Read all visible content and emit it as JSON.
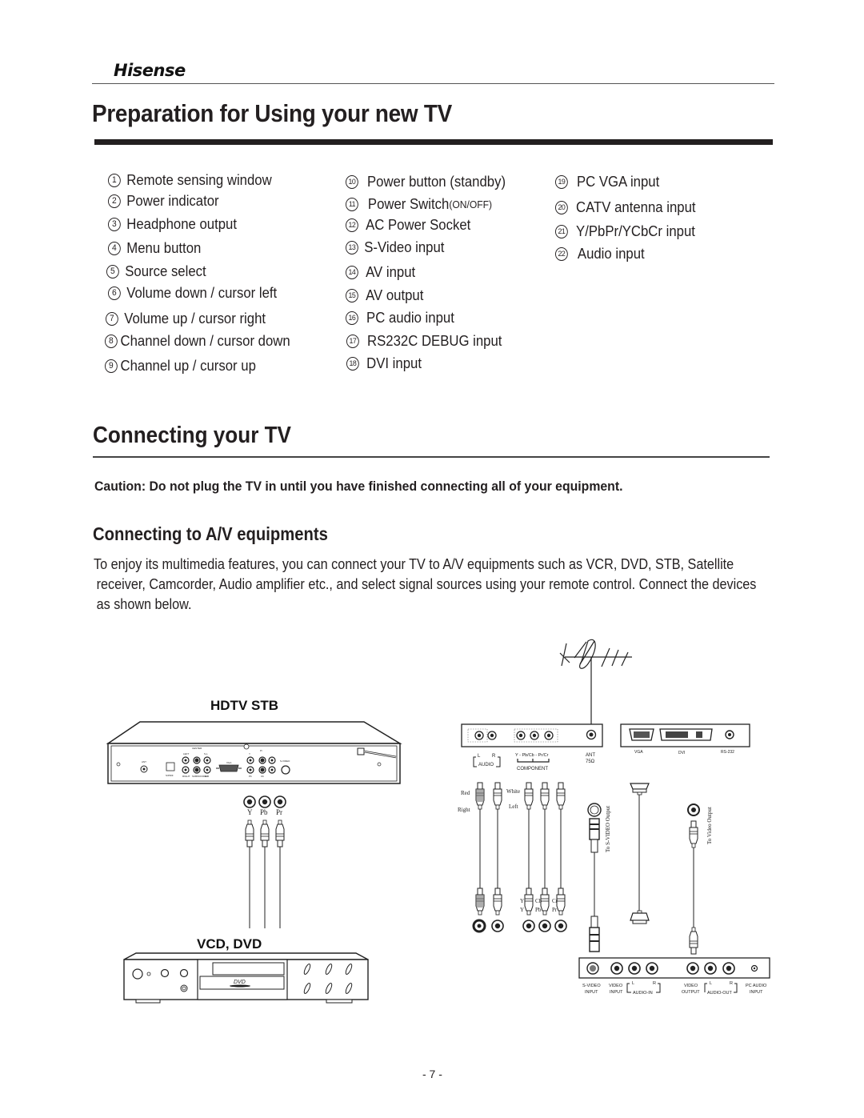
{
  "header": {
    "brand": "Hisense",
    "title": "Preparation for Using your new TV"
  },
  "legend": {
    "col1": [
      {
        "n": "1",
        "label": "Remote sensing window"
      },
      {
        "n": "2",
        "label": "Power indicator"
      },
      {
        "n": "3",
        "label": "Headphone output"
      },
      {
        "n": "4",
        "label": "Menu  button"
      },
      {
        "n": "5",
        "label": "Source select"
      },
      {
        "n": "6",
        "label": "Volume down / cursor left"
      },
      {
        "n": "7",
        "label": "Volume up / cursor right"
      },
      {
        "n": "8",
        "label": "Channel down / cursor down"
      },
      {
        "n": "9",
        "label": "Channel up / cursor up"
      }
    ],
    "col2": [
      {
        "n": "10",
        "label": "Power  button (standby)"
      },
      {
        "n": "11",
        "label": "Power  Switch",
        "suffix": "(ON/OFF)"
      },
      {
        "n": "12",
        "label": "AC Power Socket"
      },
      {
        "n": "13",
        "label": "S-Video input"
      },
      {
        "n": "14",
        "label": "AV input"
      },
      {
        "n": "15",
        "label": "AV output"
      },
      {
        "n": "16",
        "label": "PC audio input"
      },
      {
        "n": "17",
        "label": "RS232C DEBUG input"
      },
      {
        "n": "18",
        "label": "DVI input"
      }
    ],
    "col3": [
      {
        "n": "19",
        "label": "PC VGA input"
      },
      {
        "n": "20",
        "label": "CATV antenna input"
      },
      {
        "n": "21",
        "label": "Y/PbPr/YCbCr input"
      },
      {
        "n": "22",
        "label": "Audio input"
      }
    ]
  },
  "connecting": {
    "title": "Connecting your TV",
    "caution": "Caution: Do not plug the TV in until you have finished connecting all of your equipment.",
    "subtitle": "Connecting to A/V equipments",
    "paragraph": [
      "To enjoy its multimedia features, you can connect your TV to A/V equipments such as VCR, DVD, STB, Satellite",
      "receiver, Camcorder, Audio amplifier etc., and select signal sources using your remote control.  Connect the devices",
      "as shown below."
    ]
  },
  "diagram": {
    "stb_label": "HDTV STB",
    "dvd_label": "VCD, DVD",
    "dvd_logo": "DVD",
    "stb_jacks": [
      "Y",
      "Pb",
      "Pr"
    ],
    "stb_panel": {
      "ant": "ANT",
      "spdif": "S/PDIF",
      "center": "CENTER",
      "left": "LEFT",
      "right": "RIGHT",
      "subwoofer": "SUBWOOFER",
      "sl": "S-L",
      "sr": "S-R",
      "vga": "VGA",
      "svideo": "S-VIDEO",
      "y": "Y",
      "pb": "Pb",
      "pr": "Pr",
      "cb": "Cb"
    },
    "tv_panel_left": {
      "audio": "AUDIO",
      "l": "L",
      "r": "R",
      "component_line": "Y - Pb/Cb - Pr/Cr",
      "component": "COMPONENT",
      "ant": "ANT",
      "ant_ohm": "75Ω"
    },
    "tv_panel_right": {
      "vga": "VGA",
      "dvi": "DVI",
      "rs232": "RS-232"
    },
    "cable_labels": {
      "red": "Red",
      "right": "Right",
      "white": "White",
      "left": "Left",
      "to_svideo": "To S-VIDEO Output",
      "to_video": "To Video Output"
    },
    "bottom_plug_labels": {
      "y1": "Y",
      "y2": "Y",
      "cb": "Cb",
      "pb": "Pb",
      "cr": "Cr",
      "pr": "Pr"
    },
    "bottom_panel": {
      "svideo": "S-VIDEO",
      "svideo2": "INPUT",
      "video_in": "VIDEO",
      "video_in2": "INPUT",
      "audio_in": "AUDIO-IN",
      "l": "L",
      "r": "R",
      "video_out": "VIDEO",
      "video_out2": "OUTPUT",
      "audio_out": "AUDIO-OUT",
      "pc_audio": "PC AUDIO",
      "pc_audio2": "INPUT"
    }
  },
  "footer": {
    "page": "- 7 -"
  }
}
